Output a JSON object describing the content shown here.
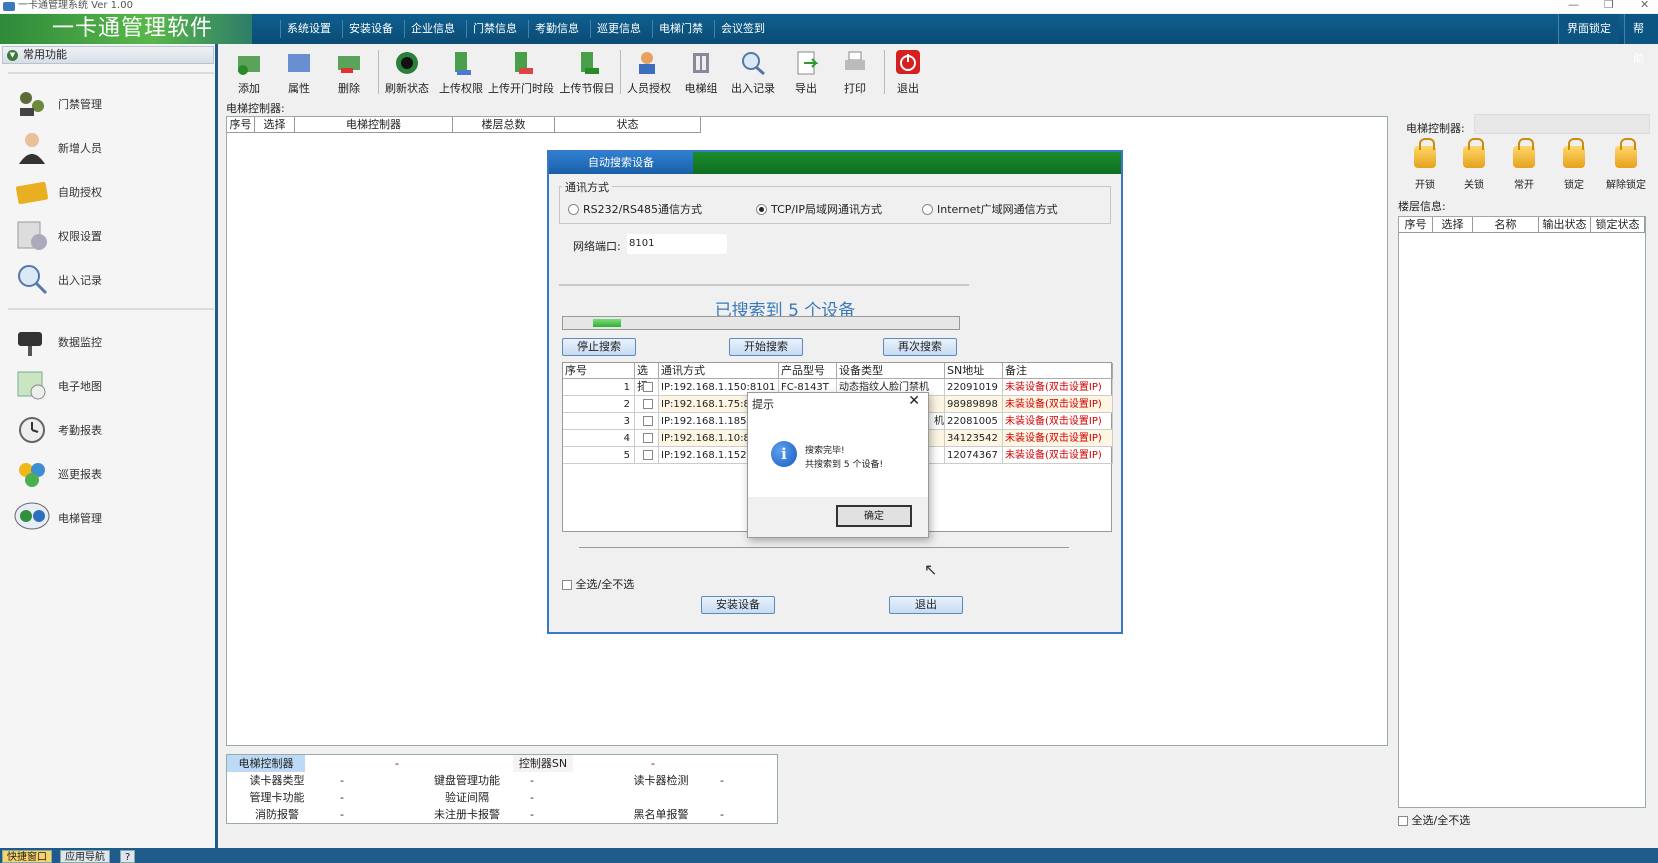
{
  "window": {
    "title": "一卡通管理系统 Ver 1.00",
    "controls": [
      "—",
      "❐",
      "✕"
    ]
  },
  "menubar": {
    "brand": "一卡通管理软件",
    "items": [
      "系统设置",
      "安装设备",
      "企业信息",
      "门禁信息",
      "考勤信息",
      "巡更信息",
      "电梯门禁",
      "会议签到"
    ],
    "right_items": [
      "界面锁定",
      "帮助"
    ]
  },
  "sidebar": {
    "header": "常用功能",
    "items": [
      {
        "label": "门禁管理",
        "icon": "access-control-icon"
      },
      {
        "label": "新增人员",
        "icon": "person-icon"
      },
      {
        "label": "自助授权",
        "icon": "card-icon"
      },
      {
        "label": "权限设置",
        "icon": "permission-icon"
      },
      {
        "label": "出入记录",
        "icon": "magnifier-icon"
      },
      {
        "label": "数据监控",
        "icon": "camera-icon"
      },
      {
        "label": "电子地图",
        "icon": "map-icon"
      },
      {
        "label": "考勤报表",
        "icon": "clock-icon"
      },
      {
        "label": "巡更报表",
        "icon": "patrol-icon"
      },
      {
        "label": "电梯管理",
        "icon": "elevator-icon"
      }
    ],
    "tabs": [
      "快捷窗口",
      "应用导航",
      "?"
    ]
  },
  "toolbar": {
    "buttons": [
      {
        "label": "添加",
        "icon": "add-icon"
      },
      {
        "label": "属性",
        "icon": "properties-icon"
      },
      {
        "label": "删除",
        "icon": "delete-icon"
      },
      {
        "label": "刷新状态",
        "icon": "refresh-icon"
      },
      {
        "label": "上传权限",
        "icon": "upload-icon"
      },
      {
        "label": "上传开门时段",
        "icon": "upload-time-icon"
      },
      {
        "label": "上传节假日",
        "icon": "upload-holiday-icon"
      },
      {
        "label": "人员授权",
        "icon": "authorize-icon"
      },
      {
        "label": "电梯组",
        "icon": "elevator-group-icon"
      },
      {
        "label": "出入记录",
        "icon": "records-icon"
      },
      {
        "label": "导出",
        "icon": "export-icon"
      },
      {
        "label": "打印",
        "icon": "print-icon"
      },
      {
        "label": "退出",
        "icon": "power-icon"
      }
    ]
  },
  "main": {
    "controller_label": "电梯控制器:",
    "grid_headers": [
      "序号",
      "选择",
      "电梯控制器",
      "楼层总数",
      "状态"
    ]
  },
  "bottom_table": {
    "row1": [
      "电梯控制器",
      "-",
      "控制器SN",
      "-"
    ],
    "row2": [
      "读卡器类型",
      "-",
      "键盘管理功能",
      "-",
      "读卡器检测",
      "-"
    ],
    "row3": [
      "管理卡功能",
      "-",
      "验证间隔",
      "-"
    ],
    "row4": [
      "消防报警",
      "-",
      "未注册卡报警",
      "-",
      "黑名单报警",
      "-"
    ]
  },
  "right_panel": {
    "controller_label": "电梯控制器:",
    "locks": [
      "开锁",
      "关锁",
      "常开",
      "锁定",
      "解除锁定"
    ],
    "floor_label": "楼层信息:",
    "grid_headers": [
      "序号",
      "选择",
      "名称",
      "输出状态",
      "锁定状态"
    ],
    "select_all": "全选/全不选"
  },
  "search_dialog": {
    "tab": "自动搜索设备",
    "comm_legend": "通讯方式",
    "radios": [
      {
        "label": "RS232/RS485通信方式",
        "checked": false
      },
      {
        "label": "TCP/IP局域网通讯方式",
        "checked": true
      },
      {
        "label": "Internet广域网通信方式",
        "checked": false
      }
    ],
    "port_label": "网络端口:",
    "port_value": "8101",
    "found_text": "已搜索到  5 个设备",
    "progress_fraction": 0.12,
    "buttons": {
      "stop": "停止搜索",
      "start": "开始搜索",
      "again": "再次搜索",
      "install": "安装设备",
      "exit": "退出"
    },
    "grid_headers": [
      "序号",
      "选择",
      "通讯方式",
      "产品型号",
      "设备类型",
      "SN地址",
      "备注"
    ],
    "rows": [
      {
        "no": "1",
        "comm": "IP:192.168.1.150:8101",
        "model": "FC-8143T",
        "type": "动态指纹人脸门禁机",
        "sn": "22091019",
        "note": "未装设备(双击设置IP)"
      },
      {
        "no": "2",
        "comm": "IP:192.168.1.75:8",
        "model": "",
        "type": "",
        "sn": "98989898",
        "note": "未装设备(双击设置IP)"
      },
      {
        "no": "3",
        "comm": "IP:192.168.1.185:",
        "model": "",
        "type": "机",
        "sn": "22081005",
        "note": "未装设备(双击设置IP)"
      },
      {
        "no": "4",
        "comm": "IP:192.168.1.10:8",
        "model": "",
        "type": "",
        "sn": "34123542",
        "note": "未装设备(双击设置IP)"
      },
      {
        "no": "5",
        "comm": "IP:192.168.1.152:",
        "model": "",
        "type": "",
        "sn": "12074367",
        "note": "未装设备(双击设置IP)"
      }
    ],
    "select_all": "全选/全不选"
  },
  "message_box": {
    "title": "提示",
    "line1": "搜索完毕!",
    "line2": "共搜索到 5 个设备!",
    "ok": "确定"
  },
  "colors": {
    "menubar": "#0a4c75",
    "brand": "#3f9a3c",
    "dialog_border": "#3a77c6",
    "warning_text": "#d20000",
    "found_text": "#3a7ab8"
  }
}
